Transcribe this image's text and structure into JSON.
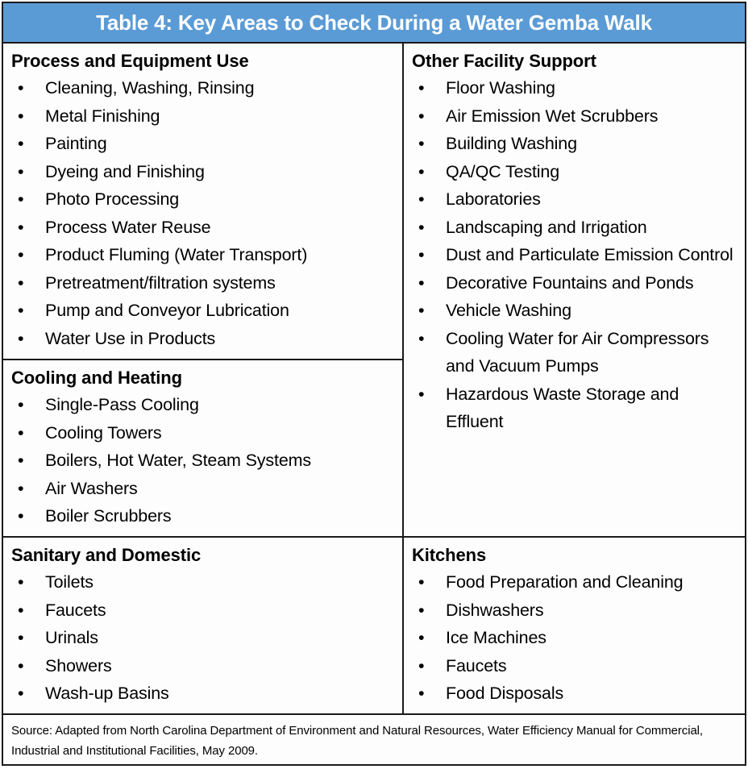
{
  "header": {
    "title": "Table 4: Key Areas to Check During a Water Gemba Walk",
    "background_color": "#5B9BD5",
    "text_color": "#FFFFFF"
  },
  "bullet_glyph": "•",
  "border_color": "#1A1A1A",
  "sections": {
    "process_equipment": {
      "title": "Process and Equipment Use",
      "items": [
        "Cleaning, Washing, Rinsing",
        "Metal Finishing",
        "Painting",
        "Dyeing and Finishing",
        "Photo Processing",
        "Process Water Reuse",
        "Product Fluming (Water Transport)",
        "Pretreatment/filtration systems",
        "Pump and Conveyor Lubrication",
        "Water Use in Products"
      ]
    },
    "cooling_heating": {
      "title": "Cooling and Heating",
      "items": [
        "Single-Pass Cooling",
        "Cooling Towers",
        "Boilers, Hot Water, Steam Systems",
        "Air Washers",
        "Boiler Scrubbers"
      ]
    },
    "sanitary_domestic": {
      "title": "Sanitary and Domestic",
      "items": [
        "Toilets",
        "Faucets",
        "Urinals",
        "Showers",
        "Wash-up Basins"
      ]
    },
    "other_facility_support": {
      "title": "Other Facility Support",
      "items": [
        "Floor Washing",
        "Air Emission Wet Scrubbers",
        "Building Washing",
        "QA/QC Testing",
        "Laboratories",
        "Landscaping and Irrigation",
        "Dust and Particulate Emission Control",
        "Decorative Fountains and Ponds",
        "Vehicle Washing",
        "Cooling Water for Air Compressors and Vacuum Pumps",
        "Hazardous Waste Storage and Effluent"
      ]
    },
    "kitchens": {
      "title": "Kitchens",
      "items": [
        "Food Preparation and Cleaning",
        "Dishwashers",
        "Ice Machines",
        "Faucets",
        "Food Disposals"
      ]
    }
  },
  "source": {
    "text": "Source: Adapted from North Carolina Department of Environment and Natural Resources, Water Efficiency Manual for Commercial, Industrial and Institutional Facilities, May 2009."
  }
}
